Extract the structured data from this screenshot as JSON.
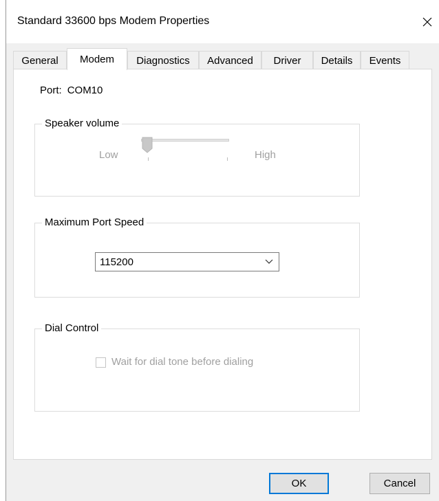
{
  "window": {
    "title": "Standard 33600 bps Modem Properties",
    "close_icon": "close-icon"
  },
  "tabs": [
    {
      "label": "General",
      "active": false
    },
    {
      "label": "Modem",
      "active": true
    },
    {
      "label": "Diagnostics",
      "active": false
    },
    {
      "label": "Advanced",
      "active": false
    },
    {
      "label": "Driver",
      "active": false
    },
    {
      "label": "Details",
      "active": false
    },
    {
      "label": "Events",
      "active": false
    }
  ],
  "modem": {
    "port_label": "Port:",
    "port_value": "COM10",
    "speaker": {
      "group_label": "Speaker volume",
      "low_label": "Low",
      "high_label": "High",
      "level": 0,
      "enabled": false
    },
    "speed": {
      "group_label": "Maximum Port Speed",
      "selected": "115200"
    },
    "dial": {
      "group_label": "Dial Control",
      "checkbox_label": "Wait for dial tone before dialing",
      "checked": false,
      "enabled": false
    }
  },
  "buttons": {
    "ok": "OK",
    "cancel": "Cancel"
  },
  "colors": {
    "accent": "#0078d7",
    "disabled_text": "#a0a0a0"
  }
}
